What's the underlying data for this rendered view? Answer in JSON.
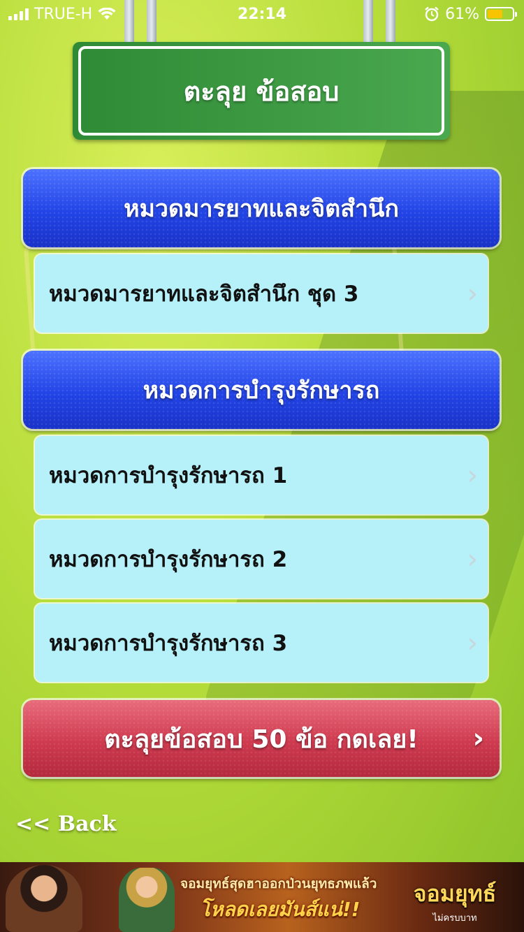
{
  "status_bar": {
    "carrier": "TRUE-H",
    "time": "22:14",
    "battery_percent": "61%",
    "battery_level": 0.61,
    "battery_color": "#f6c400",
    "icons": [
      "signal-icon",
      "wifi-icon",
      "alarm-icon",
      "battery-icon"
    ]
  },
  "header": {
    "title": "ตะลุย ข้อสอบ"
  },
  "sections": [
    {
      "title": "หมวดมารยาทและจิตสำนึก",
      "items": [
        {
          "label": "หมวดมารยาทและจิตสำนึก ชุด 3"
        }
      ]
    },
    {
      "title": "หมวดการบำรุงรักษารถ",
      "items": [
        {
          "label": "หมวดการบำรุงรักษารถ 1"
        },
        {
          "label": "หมวดการบำรุงรักษารถ 2"
        },
        {
          "label": "หมวดการบำรุงรักษารถ 3"
        }
      ]
    }
  ],
  "quiz_button": {
    "label": "ตะลุยข้อสอบ 50 ข้อ กดเลย!"
  },
  "back": {
    "label": "<< Back"
  },
  "ad": {
    "line1": "จอมยุทธ์สุดฮาออกป่วนยุทธภพแล้ว",
    "line2": "โหลดเลยมันส์แน่!!",
    "logo_title": "จอมยุทธ์",
    "logo_subtitle": "ไม่ครบบาท"
  },
  "colors": {
    "header_blue": "#2244e6",
    "row_bg": "#b6f0f8",
    "quiz_red": "#cf3a4f",
    "title_green": "#2f8a35"
  }
}
